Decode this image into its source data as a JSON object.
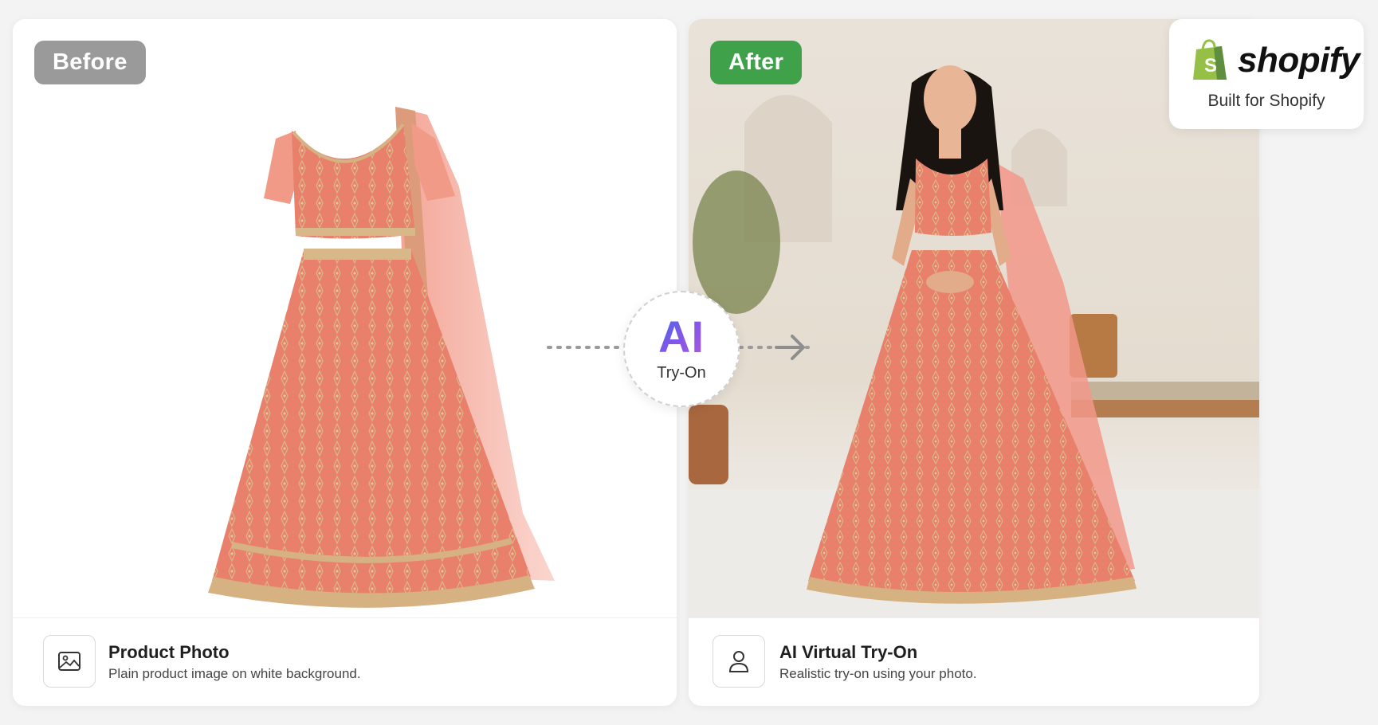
{
  "before_card": {
    "badge": "Before",
    "footer_title": "Product Photo",
    "footer_desc": "Plain product image on white background.",
    "icon": "image-icon"
  },
  "after_card": {
    "badge": "After",
    "footer_title": "AI Virtual Try-On",
    "footer_desc": "Realistic try-on using your photo.",
    "icon": "person-icon"
  },
  "center": {
    "ai_label": "AI",
    "sub_label": "Try-On"
  },
  "shopify": {
    "brand": "shopify",
    "tagline": "Built for Shopify",
    "icon": "shopify-bag-icon"
  },
  "colors": {
    "before_badge": "#9a9a9a",
    "after_badge": "#3fa24a",
    "garment": "#e8806c",
    "shopify_green": "#95bf47",
    "ai_gradient_start": "#3d6cf0",
    "ai_gradient_end": "#b05ad9"
  }
}
